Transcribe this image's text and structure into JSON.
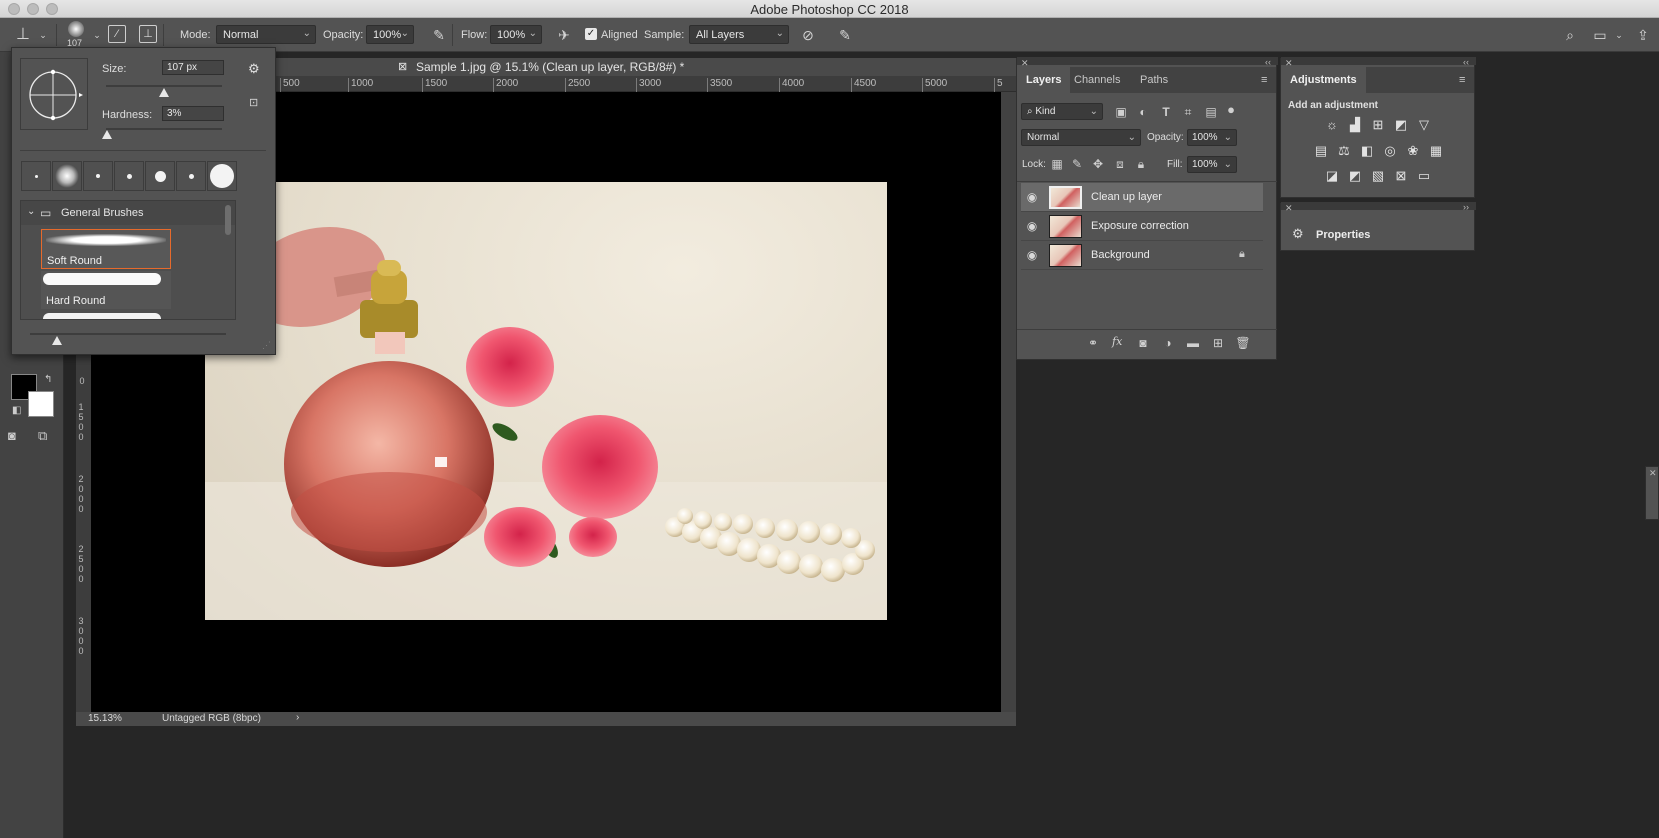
{
  "window": {
    "title": "Adobe Photoshop CC 2018"
  },
  "options_bar": {
    "tool_icon": "clone-stamp-icon",
    "brush_size_label": "107",
    "mode_label": "Mode:",
    "mode_value": "Normal",
    "opacity_label": "Opacity:",
    "opacity_value": "100%",
    "flow_label": "Flow:",
    "flow_value": "100%",
    "aligned_label": "Aligned",
    "aligned_checked": true,
    "sample_label": "Sample:",
    "sample_value": "All Layers"
  },
  "document": {
    "tab_title": "Sample 1.jpg @ 15.1% (Clean up layer, RGB/8#) *",
    "ruler_top": [
      "500",
      "1000",
      "1500",
      "2000",
      "2500",
      "3000",
      "3500",
      "4000",
      "4500",
      "5000",
      "5"
    ],
    "ruler_left": [
      "0",
      "1500",
      "2000",
      "2500",
      "3000"
    ],
    "status_zoom": "15.13%",
    "status_profile": "Untagged RGB (8bpc)",
    "status_arrow": "›"
  },
  "brush_picker": {
    "size_label": "Size:",
    "size_value": "107 px",
    "size_level": 0.5,
    "hardness_label": "Hardness:",
    "hardness_value": "3%",
    "group_name": "General Brushes",
    "brushes": [
      {
        "name": "Soft Round",
        "selected": true
      },
      {
        "name": "Hard Round",
        "selected": false
      }
    ]
  },
  "layers_panel": {
    "tabs": [
      "Layers",
      "Channels",
      "Paths"
    ],
    "active_tab": "Layers",
    "filter_value": "Kind",
    "blend_mode": "Normal",
    "opacity_label": "Opacity:",
    "opacity_value": "100%",
    "lock_label": "Lock:",
    "fill_label": "Fill:",
    "fill_value": "100%",
    "layers": [
      {
        "name": "Clean up layer",
        "visible": true,
        "selected": true,
        "locked": false
      },
      {
        "name": "Exposure correction",
        "visible": true,
        "selected": false,
        "locked": false
      },
      {
        "name": "Background",
        "visible": true,
        "selected": false,
        "locked": true
      }
    ],
    "footer_fx": "fx"
  },
  "adjustments_panel": {
    "tab": "Adjustments",
    "heading": "Add an adjustment"
  },
  "properties_panel": {
    "title": "Properties"
  },
  "colors": {
    "accent_selected": "#e66a2c",
    "foreground": "#000000",
    "background": "#ffffff"
  }
}
